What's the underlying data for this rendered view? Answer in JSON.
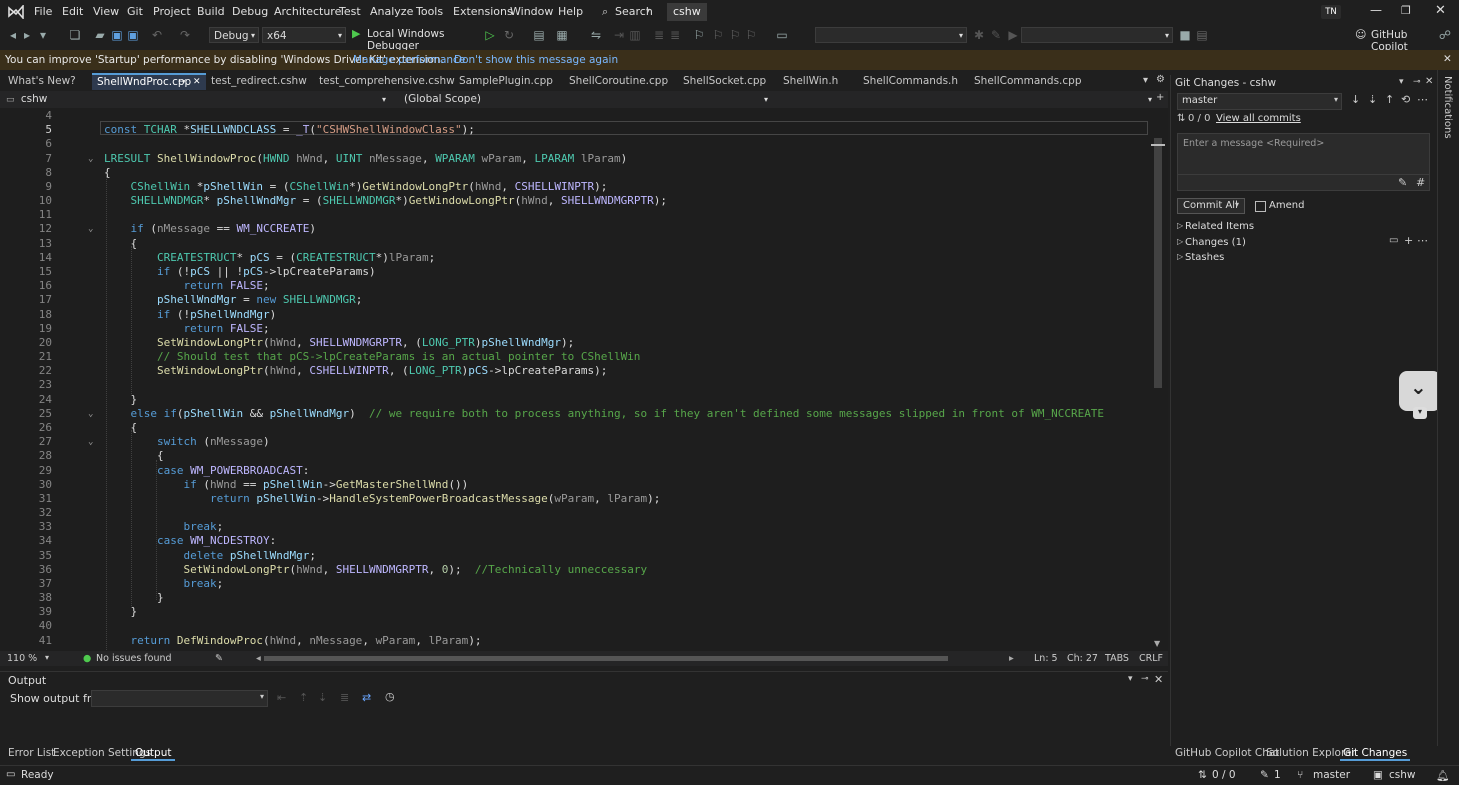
{
  "menu": {
    "items": [
      "File",
      "Edit",
      "View",
      "Git",
      "Project",
      "Build",
      "Debug",
      "Architecture",
      "Test",
      "Analyze",
      "Tools",
      "Extensions",
      "Window",
      "Help"
    ],
    "search": "Search",
    "solution_badge": "cshw",
    "user_initials": "TN",
    "copilot": "GitHub Copilot"
  },
  "toolbar": {
    "configuration": "Debug",
    "platform": "x64",
    "run_target": "Local Windows Debugger"
  },
  "infobar": {
    "message": "You can improve 'Startup' performance by disabling 'Windows Driver Kit' extension.",
    "link1": "Manage performance",
    "link2": "Don't show this message again"
  },
  "tabs": [
    "What's New?",
    "ShellWndProc.cpp",
    "test_redirect.cshw",
    "test_comprehensive.cshw",
    "SamplePlugin.cpp",
    "ShellCoroutine.cpp",
    "ShellSocket.cpp",
    "ShellWin.h",
    "ShellCommands.h",
    "ShellCommands.cpp"
  ],
  "navbar": {
    "project": "cshw",
    "scope": "(Global Scope)"
  },
  "code": {
    "lines": [
      {
        "n": "4",
        "fold": "",
        "segs": []
      },
      {
        "n": "5",
        "fold": "",
        "segs": [
          [
            "kw",
            "const "
          ],
          [
            "ty",
            "TCHAR "
          ],
          [
            "pl",
            "*"
          ],
          [
            "var",
            "SHELLWNDCLASS"
          ],
          [
            "pl",
            " = "
          ],
          [
            "mac",
            "_T"
          ],
          [
            "pl",
            "("
          ],
          [
            "str",
            "\"CSHWShellWindowClass\""
          ],
          [
            "pl",
            ");"
          ]
        ]
      },
      {
        "n": "6",
        "fold": "",
        "segs": []
      },
      {
        "n": "7",
        "fold": "v",
        "segs": [
          [
            "ty",
            "LRESULT "
          ],
          [
            "fn",
            "ShellWindowProc"
          ],
          [
            "pl",
            "("
          ],
          [
            "ty",
            "HWND "
          ],
          [
            "par",
            "hWnd"
          ],
          [
            "pl",
            ", "
          ],
          [
            "ty",
            "UINT "
          ],
          [
            "par",
            "nMessage"
          ],
          [
            "pl",
            ", "
          ],
          [
            "ty",
            "WPARAM "
          ],
          [
            "par",
            "wParam"
          ],
          [
            "pl",
            ", "
          ],
          [
            "ty",
            "LPARAM "
          ],
          [
            "par",
            "lParam"
          ],
          [
            "pl",
            ")"
          ]
        ]
      },
      {
        "n": "8",
        "fold": "",
        "segs": [
          [
            "pl",
            "{"
          ]
        ]
      },
      {
        "n": "9",
        "fold": "",
        "segs": [
          [
            "pl",
            "    "
          ],
          [
            "ty",
            "CShellWin "
          ],
          [
            "pl",
            "*"
          ],
          [
            "var",
            "pShellWin"
          ],
          [
            "pl",
            " = ("
          ],
          [
            "ty",
            "CShellWin"
          ],
          [
            "pl",
            "*)"
          ],
          [
            "fn",
            "GetWindowLongPtr"
          ],
          [
            "pl",
            "("
          ],
          [
            "par",
            "hWnd"
          ],
          [
            "pl",
            ", "
          ],
          [
            "mac",
            "CSHELLWINPTR"
          ],
          [
            "pl",
            ");"
          ]
        ]
      },
      {
        "n": "10",
        "fold": "",
        "segs": [
          [
            "pl",
            "    "
          ],
          [
            "ty",
            "SHELLWNDMGR"
          ],
          [
            "pl",
            "* "
          ],
          [
            "var",
            "pShellWndMgr"
          ],
          [
            "pl",
            " = ("
          ],
          [
            "ty",
            "SHELLWNDMGR"
          ],
          [
            "pl",
            "*)"
          ],
          [
            "fn",
            "GetWindowLongPtr"
          ],
          [
            "pl",
            "("
          ],
          [
            "par",
            "hWnd"
          ],
          [
            "pl",
            ", "
          ],
          [
            "mac",
            "SHELLWNDMGRPTR"
          ],
          [
            "pl",
            ");"
          ]
        ]
      },
      {
        "n": "11",
        "fold": "",
        "segs": []
      },
      {
        "n": "12",
        "fold": "v",
        "segs": [
          [
            "pl",
            "    "
          ],
          [
            "kw",
            "if "
          ],
          [
            "pl",
            "("
          ],
          [
            "par",
            "nMessage"
          ],
          [
            "pl",
            " == "
          ],
          [
            "mac",
            "WM_NCCREATE"
          ],
          [
            "pl",
            ")"
          ]
        ]
      },
      {
        "n": "13",
        "fold": "",
        "segs": [
          [
            "pl",
            "    {"
          ]
        ]
      },
      {
        "n": "14",
        "fold": "",
        "segs": [
          [
            "pl",
            "        "
          ],
          [
            "ty",
            "CREATESTRUCT"
          ],
          [
            "pl",
            "* "
          ],
          [
            "var",
            "pCS"
          ],
          [
            "pl",
            " = ("
          ],
          [
            "ty",
            "CREATESTRUCT"
          ],
          [
            "pl",
            "*)"
          ],
          [
            "par",
            "lParam"
          ],
          [
            "pl",
            ";"
          ]
        ]
      },
      {
        "n": "15",
        "fold": "",
        "segs": [
          [
            "pl",
            "        "
          ],
          [
            "kw",
            "if "
          ],
          [
            "pl",
            "(!"
          ],
          [
            "var",
            "pCS"
          ],
          [
            "pl",
            " || !"
          ],
          [
            "var",
            "pCS"
          ],
          [
            "pl",
            "->"
          ],
          [
            "mem",
            "lpCreateParams"
          ],
          [
            "pl",
            ")"
          ]
        ]
      },
      {
        "n": "16",
        "fold": "",
        "segs": [
          [
            "pl",
            "            "
          ],
          [
            "kw",
            "return "
          ],
          [
            "mac",
            "FALSE"
          ],
          [
            "pl",
            ";"
          ]
        ]
      },
      {
        "n": "17",
        "fold": "",
        "segs": [
          [
            "pl",
            "        "
          ],
          [
            "var",
            "pShellWndMgr"
          ],
          [
            "pl",
            " = "
          ],
          [
            "kw",
            "new "
          ],
          [
            "ty",
            "SHELLWNDMGR"
          ],
          [
            "pl",
            ";"
          ]
        ]
      },
      {
        "n": "18",
        "fold": "",
        "segs": [
          [
            "pl",
            "        "
          ],
          [
            "kw",
            "if "
          ],
          [
            "pl",
            "(!"
          ],
          [
            "var",
            "pShellWndMgr"
          ],
          [
            "pl",
            ")"
          ]
        ]
      },
      {
        "n": "19",
        "fold": "",
        "segs": [
          [
            "pl",
            "            "
          ],
          [
            "kw",
            "return "
          ],
          [
            "mac",
            "FALSE"
          ],
          [
            "pl",
            ";"
          ]
        ]
      },
      {
        "n": "20",
        "fold": "",
        "segs": [
          [
            "pl",
            "        "
          ],
          [
            "fn",
            "SetWindowLongPtr"
          ],
          [
            "pl",
            "("
          ],
          [
            "par",
            "hWnd"
          ],
          [
            "pl",
            ", "
          ],
          [
            "mac",
            "SHELLWNDMGRPTR"
          ],
          [
            "pl",
            ", ("
          ],
          [
            "ty",
            "LONG_PTR"
          ],
          [
            "pl",
            ")"
          ],
          [
            "var",
            "pShellWndMgr"
          ],
          [
            "pl",
            ");"
          ]
        ]
      },
      {
        "n": "21",
        "fold": "",
        "segs": [
          [
            "pl",
            "        "
          ],
          [
            "cm",
            "// Should test that pCS->lpCreateParams is an actual pointer to CShellWin"
          ]
        ]
      },
      {
        "n": "22",
        "fold": "",
        "segs": [
          [
            "pl",
            "        "
          ],
          [
            "fn",
            "SetWindowLongPtr"
          ],
          [
            "pl",
            "("
          ],
          [
            "par",
            "hWnd"
          ],
          [
            "pl",
            ", "
          ],
          [
            "mac",
            "CSHELLWINPTR"
          ],
          [
            "pl",
            ", ("
          ],
          [
            "ty",
            "LONG_PTR"
          ],
          [
            "pl",
            ")"
          ],
          [
            "var",
            "pCS"
          ],
          [
            "pl",
            "->"
          ],
          [
            "mem",
            "lpCreateParams"
          ],
          [
            "pl",
            ");"
          ]
        ]
      },
      {
        "n": "23",
        "fold": "",
        "segs": []
      },
      {
        "n": "24",
        "fold": "",
        "segs": [
          [
            "pl",
            "    }"
          ]
        ]
      },
      {
        "n": "25",
        "fold": "v",
        "segs": [
          [
            "pl",
            "    "
          ],
          [
            "kw",
            "else if"
          ],
          [
            "pl",
            "("
          ],
          [
            "var",
            "pShellWin"
          ],
          [
            "pl",
            " && "
          ],
          [
            "var",
            "pShellWndMgr"
          ],
          [
            "pl",
            ")  "
          ],
          [
            "cm",
            "// we require both to process anything, so if they aren't defined some messages slipped in front of WM_NCCREATE"
          ]
        ]
      },
      {
        "n": "26",
        "fold": "",
        "segs": [
          [
            "pl",
            "    {"
          ]
        ]
      },
      {
        "n": "27",
        "fold": "v",
        "segs": [
          [
            "pl",
            "        "
          ],
          [
            "kw",
            "switch "
          ],
          [
            "pl",
            "("
          ],
          [
            "par",
            "nMessage"
          ],
          [
            "pl",
            ")"
          ]
        ]
      },
      {
        "n": "28",
        "fold": "",
        "segs": [
          [
            "pl",
            "        {"
          ]
        ]
      },
      {
        "n": "29",
        "fold": "",
        "segs": [
          [
            "pl",
            "        "
          ],
          [
            "kw",
            "case "
          ],
          [
            "mac",
            "WM_POWERBROADCAST"
          ],
          [
            "pl",
            ":"
          ]
        ]
      },
      {
        "n": "30",
        "fold": "",
        "segs": [
          [
            "pl",
            "            "
          ],
          [
            "kw",
            "if "
          ],
          [
            "pl",
            "("
          ],
          [
            "par",
            "hWnd"
          ],
          [
            "pl",
            " == "
          ],
          [
            "var",
            "pShellWin"
          ],
          [
            "pl",
            "->"
          ],
          [
            "fn",
            "GetMasterShellWnd"
          ],
          [
            "pl",
            "())"
          ]
        ]
      },
      {
        "n": "31",
        "fold": "",
        "segs": [
          [
            "pl",
            "                "
          ],
          [
            "kw",
            "return "
          ],
          [
            "var",
            "pShellWin"
          ],
          [
            "pl",
            "->"
          ],
          [
            "fn",
            "HandleSystemPowerBroadcastMessage"
          ],
          [
            "pl",
            "("
          ],
          [
            "par",
            "wParam"
          ],
          [
            "pl",
            ", "
          ],
          [
            "par",
            "lParam"
          ],
          [
            "pl",
            ");"
          ]
        ]
      },
      {
        "n": "32",
        "fold": "",
        "segs": []
      },
      {
        "n": "33",
        "fold": "",
        "segs": [
          [
            "pl",
            "            "
          ],
          [
            "kw",
            "break"
          ],
          [
            "pl",
            ";"
          ]
        ]
      },
      {
        "n": "34",
        "fold": "",
        "segs": [
          [
            "pl",
            "        "
          ],
          [
            "kw",
            "case "
          ],
          [
            "mac",
            "WM_NCDESTROY"
          ],
          [
            "pl",
            ":"
          ]
        ]
      },
      {
        "n": "35",
        "fold": "",
        "segs": [
          [
            "pl",
            "            "
          ],
          [
            "kw",
            "delete "
          ],
          [
            "var",
            "pShellWndMgr"
          ],
          [
            "pl",
            ";"
          ]
        ]
      },
      {
        "n": "36",
        "fold": "",
        "segs": [
          [
            "pl",
            "            "
          ],
          [
            "fn",
            "SetWindowLongPtr"
          ],
          [
            "pl",
            "("
          ],
          [
            "par",
            "hWnd"
          ],
          [
            "pl",
            ", "
          ],
          [
            "mac",
            "SHELLWNDMGRPTR"
          ],
          [
            "pl",
            ", "
          ],
          [
            "num",
            "0"
          ],
          [
            "pl",
            ");  "
          ],
          [
            "cm",
            "//Technically unneccessary"
          ]
        ]
      },
      {
        "n": "37",
        "fold": "",
        "segs": [
          [
            "pl",
            "            "
          ],
          [
            "kw",
            "break"
          ],
          [
            "pl",
            ";"
          ]
        ]
      },
      {
        "n": "38",
        "fold": "",
        "segs": [
          [
            "pl",
            "        }"
          ]
        ]
      },
      {
        "n": "39",
        "fold": "",
        "segs": [
          [
            "pl",
            "    }"
          ]
        ]
      },
      {
        "n": "40",
        "fold": "",
        "segs": []
      },
      {
        "n": "41",
        "fold": "",
        "segs": [
          [
            "pl",
            "    "
          ],
          [
            "kw",
            "return "
          ],
          [
            "fn",
            "DefWindowProc"
          ],
          [
            "pl",
            "("
          ],
          [
            "par",
            "hWnd"
          ],
          [
            "pl",
            ", "
          ],
          [
            "par",
            "nMessage"
          ],
          [
            "pl",
            ", "
          ],
          [
            "par",
            "wParam"
          ],
          [
            "pl",
            ", "
          ],
          [
            "par",
            "lParam"
          ],
          [
            "pl",
            ");"
          ]
        ]
      }
    ]
  },
  "editor_status": {
    "zoom": "110 %",
    "issues": "No issues found",
    "ln": "Ln: 5",
    "ch": "Ch: 27",
    "indent": "TABS",
    "eol": "CRLF"
  },
  "output": {
    "title": "Output",
    "show_from_label": "Show output from:",
    "show_from_value": ""
  },
  "bottom_tabs": [
    "Error List",
    "Exception Settings",
    "Output"
  ],
  "git": {
    "title": "Git Changes - cshw",
    "branch": "master",
    "commits": "0 / 0",
    "view_all": "View all commits",
    "message_placeholder": "Enter a message <Required>",
    "commit_all": "Commit All",
    "amend": "Amend",
    "sections": [
      "Related Items",
      "Changes (1)",
      "Stashes"
    ]
  },
  "right_tabs": [
    "GitHub Copilot Chat",
    "Solution Explorer",
    "Git Changes"
  ],
  "notifications_label": "Notifications",
  "statusbar": {
    "ready": "Ready",
    "commits": "0 / 0",
    "pending": "1",
    "branch": "master",
    "repo": "cshw"
  }
}
